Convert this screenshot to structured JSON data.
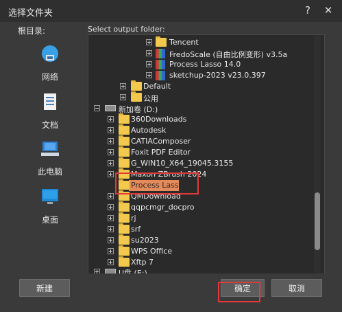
{
  "window": {
    "title": "选择文件夹",
    "help_glyph": "?",
    "close_glyph": "✕"
  },
  "labels": {
    "root": "根目录:",
    "select_folder": "Select output folder:"
  },
  "sidebar": {
    "items": [
      {
        "label": "网络",
        "icon": "network-icon"
      },
      {
        "label": "文档",
        "icon": "document-icon"
      },
      {
        "label": "此电脑",
        "icon": "computer-icon"
      },
      {
        "label": "桌面",
        "icon": "desktop-icon"
      }
    ]
  },
  "tree": {
    "rows": [
      {
        "text": "Tencent",
        "kind": "folder",
        "expand": "plus",
        "level": 3
      },
      {
        "text": "FredoScale (自由比例变形) v3.5a",
        "kind": "app",
        "expand": "plus",
        "level": 3
      },
      {
        "text": "Process Lasso 14.0",
        "kind": "app",
        "expand": "plus",
        "level": 3
      },
      {
        "text": "sketchup-2023 v23.0.397",
        "kind": "app",
        "expand": "plus",
        "level": 3
      },
      {
        "text": "Default",
        "kind": "folder",
        "expand": "plus",
        "level": 2
      },
      {
        "text": "公用",
        "kind": "folder",
        "expand": "plus",
        "level": 2
      },
      {
        "text": "新加卷 (D:)",
        "kind": "drive",
        "expand": "minus",
        "level": 0
      },
      {
        "text": "360Downloads",
        "kind": "folder",
        "expand": "plus",
        "level": 1
      },
      {
        "text": "Autodesk",
        "kind": "folder",
        "expand": "plus",
        "level": 1
      },
      {
        "text": "CATIAComposer",
        "kind": "folder",
        "expand": "plus",
        "level": 1
      },
      {
        "text": "Foxit PDF Editor",
        "kind": "folder",
        "expand": "plus",
        "level": 1
      },
      {
        "text": "G_WIN10_X64_19045.3155",
        "kind": "folder",
        "expand": "plus",
        "level": 1
      },
      {
        "text": "Maxon ZBrush 2024",
        "kind": "folder",
        "expand": "plus",
        "level": 1
      },
      {
        "text": "Process Lasso",
        "kind": "folder",
        "expand": "none",
        "level": 1,
        "selected": true
      },
      {
        "text": "QMDownload",
        "kind": "folder",
        "expand": "plus",
        "level": 1
      },
      {
        "text": "qqpcmgr_docpro",
        "kind": "folder",
        "expand": "plus",
        "level": 1
      },
      {
        "text": "rj",
        "kind": "folder",
        "expand": "plus",
        "level": 1
      },
      {
        "text": "srf",
        "kind": "folder",
        "expand": "plus",
        "level": 1
      },
      {
        "text": "su2023",
        "kind": "folder",
        "expand": "plus",
        "level": 1
      },
      {
        "text": "WPS Office",
        "kind": "folder",
        "expand": "plus",
        "level": 1
      },
      {
        "text": "Xftp 7",
        "kind": "folder",
        "expand": "plus",
        "level": 1
      },
      {
        "text": "U盘 (E:)",
        "kind": "drive",
        "expand": "plus",
        "level": 0
      }
    ]
  },
  "footer": {
    "new_label": "新建",
    "ok_label": "确定",
    "cancel_label": "取消"
  },
  "colors": {
    "selection": "#e58a5a",
    "highlight": "#e23a3a",
    "folder": "#f2c94c"
  }
}
